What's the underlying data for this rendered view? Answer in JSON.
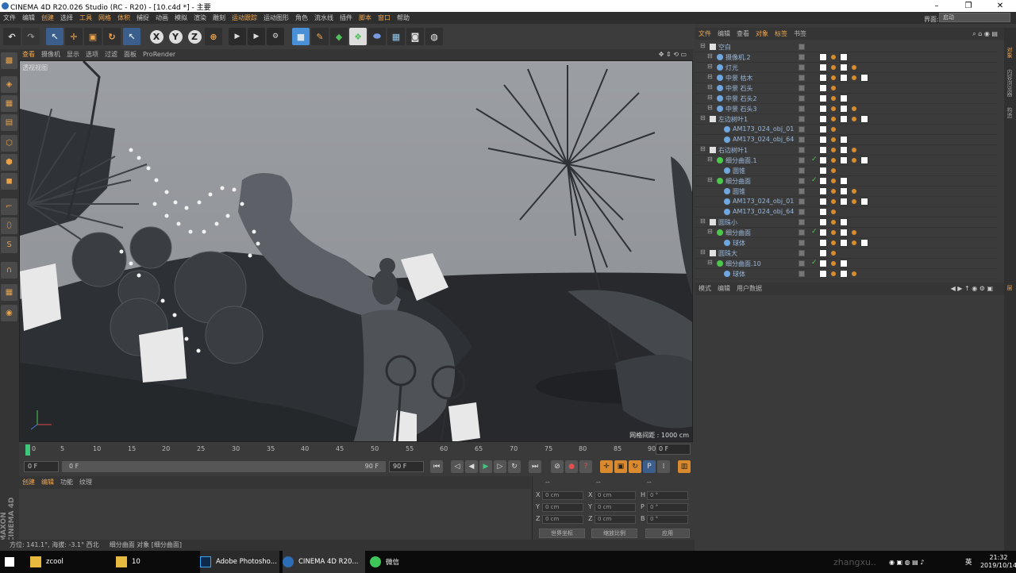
{
  "window": {
    "title": "CINEMA 4D R20.026 Studio (RC - R20) - [10.c4d *] - 主要",
    "buttons": {
      "minimize": "–",
      "maximize": "❐",
      "close": "✕"
    }
  },
  "menubar": {
    "items": [
      "文件",
      "编辑",
      "创建",
      "选择",
      "工具",
      "网格",
      "体积",
      "捕捉",
      "动画",
      "模拟",
      "渲染",
      "雕刻",
      "运动跟踪",
      "运动图形",
      "角色",
      "流水线",
      "插件",
      "脚本",
      "窗口",
      "帮助"
    ],
    "layout_label": "界面:",
    "layout_value": "启动"
  },
  "toolbar": {
    "axes": [
      "X",
      "Y",
      "Z"
    ]
  },
  "viewport": {
    "menu": [
      "查看",
      "摄像机",
      "显示",
      "选项",
      "过滤",
      "面板",
      "ProRender"
    ],
    "label": "透视视图",
    "grid_label": "网格间距 : 1000 cm"
  },
  "timeline": {
    "ticks": [
      "0",
      "5",
      "10",
      "15",
      "20",
      "25",
      "30",
      "35",
      "40",
      "45",
      "50",
      "55",
      "60",
      "65",
      "70",
      "75",
      "80",
      "85",
      "90"
    ],
    "current_frame": "0 F"
  },
  "transport": {
    "start": "0 F",
    "slider_left": "0 F",
    "slider_right": "90 F",
    "end": "90 F"
  },
  "material": {
    "tabs": [
      "创建",
      "编辑",
      "功能",
      "纹理"
    ]
  },
  "coords": {
    "headers": [
      "--",
      "--",
      "--"
    ],
    "rows": [
      {
        "l1": "X",
        "v1": "0 cm",
        "l2": "X",
        "v2": "0 cm",
        "l3": "H",
        "v3": "0 °"
      },
      {
        "l1": "Y",
        "v1": "0 cm",
        "l2": "Y",
        "v2": "0 cm",
        "l3": "P",
        "v3": "0 °"
      },
      {
        "l1": "Z",
        "v1": "0 cm",
        "l2": "Z",
        "v2": "0 cm",
        "l3": "B",
        "v3": "0 °"
      }
    ],
    "mode1": "世界坐标",
    "mode2": "缩放比例",
    "apply": "应用"
  },
  "status": "方位: 141.1°, 海拔: -3.1° 西北 　 细分曲面 对象 [细分曲面]",
  "object_manager": {
    "tabs": [
      "文件",
      "编辑",
      "查看",
      "对象",
      "标签",
      "书签"
    ],
    "rows": [
      {
        "name": "空白",
        "indent": 0
      },
      {
        "name": "摄像机.2",
        "indent": 1
      },
      {
        "name": "灯光",
        "indent": 1
      },
      {
        "name": "中景 枯木",
        "indent": 1
      },
      {
        "name": "中景 石头",
        "indent": 1
      },
      {
        "name": "中景 石头2",
        "indent": 1
      },
      {
        "name": "中景 石头3",
        "indent": 1
      },
      {
        "name": "左边树叶1",
        "indent": 0
      },
      {
        "name": "AM173_024_obj_01",
        "indent": 2
      },
      {
        "name": "AM173_024_obj_64",
        "indent": 2
      },
      {
        "name": "右边树叶1",
        "indent": 0
      },
      {
        "name": "细分曲面.1",
        "indent": 1
      },
      {
        "name": "圆锥",
        "indent": 2
      },
      {
        "name": "细分曲面",
        "indent": 1
      },
      {
        "name": "圆锥",
        "indent": 2
      },
      {
        "name": "AM173_024_obj_01",
        "indent": 2
      },
      {
        "name": "AM173_024_obj_64",
        "indent": 2
      },
      {
        "name": "圆珠小",
        "indent": 0
      },
      {
        "name": "细分曲面",
        "indent": 1
      },
      {
        "name": "球体",
        "indent": 2
      },
      {
        "name": "圆珠大",
        "indent": 0
      },
      {
        "name": "细分曲面.10",
        "indent": 1
      },
      {
        "name": "球体",
        "indent": 2
      }
    ]
  },
  "attributes": {
    "tabs": [
      "模式",
      "编辑",
      "用户数据"
    ]
  },
  "right_strip": [
    "对象",
    "内容浏览器",
    "构造",
    "层"
  ],
  "taskbar": {
    "items": [
      "zcool",
      "10",
      "Adobe Photosho...",
      "CINEMA 4D R20...",
      "微信"
    ],
    "watermark": "zhangxu..",
    "ime": "英",
    "time": "21:32",
    "date": "2019/10/14"
  },
  "maxon_logo": "MAXON CINEMA 4D",
  "colors": {
    "accent": "#f0a64e",
    "selection_blue": "#3b5e8c",
    "play_green": "#3ec67a"
  }
}
